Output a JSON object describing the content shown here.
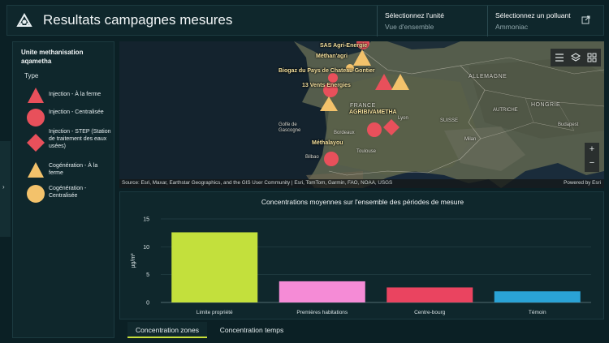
{
  "header": {
    "title": "Resultats campagnes mesures",
    "unit_label": "Sélectionnez l'unité",
    "unit_value": "Vue d'ensemble",
    "pollutant_label": "Sélectionnez un polluant",
    "pollutant_value": "Ammoniac",
    "icons": [
      "app-logo-icon",
      "external-link-icon"
    ]
  },
  "sidebar_toggle": "›",
  "legend": {
    "title": "Unite methanisation aqametha",
    "subtitle": "Type",
    "items": [
      {
        "label": "Injection - À la ferme",
        "symbol": "triangle",
        "color": "#e8505b"
      },
      {
        "label": "Injection - Centralisée",
        "symbol": "circle",
        "color": "#e8505b"
      },
      {
        "label": "Injection - STEP (Station de traitement des eaux usées)",
        "symbol": "diamond",
        "color": "#e8505b"
      },
      {
        "label": "Cogénération - À la ferme",
        "symbol": "triangle",
        "color": "#f3c26b"
      },
      {
        "label": "Cogénération - Centralisée",
        "symbol": "circle",
        "color": "#f3c26b"
      }
    ]
  },
  "map": {
    "site_labels": [
      "SAS Agri-Energie",
      "Méthan'agri",
      "Biogaz du Pays de Chateau-Gontier",
      "13 Vents Energies",
      "AGRIBIVAMETHA",
      "Méthalayou"
    ],
    "place_labels": [
      "FRANCE",
      "Golfe de Gascogne",
      "Bordeaux",
      "Toulouse",
      "Bilbao",
      "Lyon",
      "ALLEMAGNE",
      "HONGRIE",
      "SUISSE",
      "AUTRICHE",
      "Milan",
      "Budapest"
    ],
    "attribution": "Source: Esri, Maxar, Earthstar Geographics, and the GIS User Community | Esri, TomTom, Garmin, FAO, NOAA, USGS",
    "powered_by": "Powered by Esri",
    "zoom_in": "+",
    "zoom_out": "−",
    "tool_icons": [
      "legend-list-icon",
      "layers-icon",
      "basemap-gallery-icon"
    ]
  },
  "chart_data": {
    "type": "bar",
    "title": "Concentrations moyennes sur l'ensemble des périodes de mesure",
    "ylabel": "µg/m³",
    "ylim": [
      0,
      15
    ],
    "yticks": [
      0,
      5,
      10,
      15
    ],
    "categories": [
      "Limite propriété",
      "Premières habitations",
      "Centre-bourg",
      "Témoin"
    ],
    "values": [
      12.6,
      3.8,
      2.7,
      2.0
    ],
    "colors": [
      "#c3e03c",
      "#f58bd6",
      "#ea4460",
      "#2aa3d6"
    ],
    "grid": true
  },
  "tabs": [
    {
      "label": "Concentration zones",
      "active": true
    },
    {
      "label": "Concentration temps",
      "active": false
    }
  ]
}
